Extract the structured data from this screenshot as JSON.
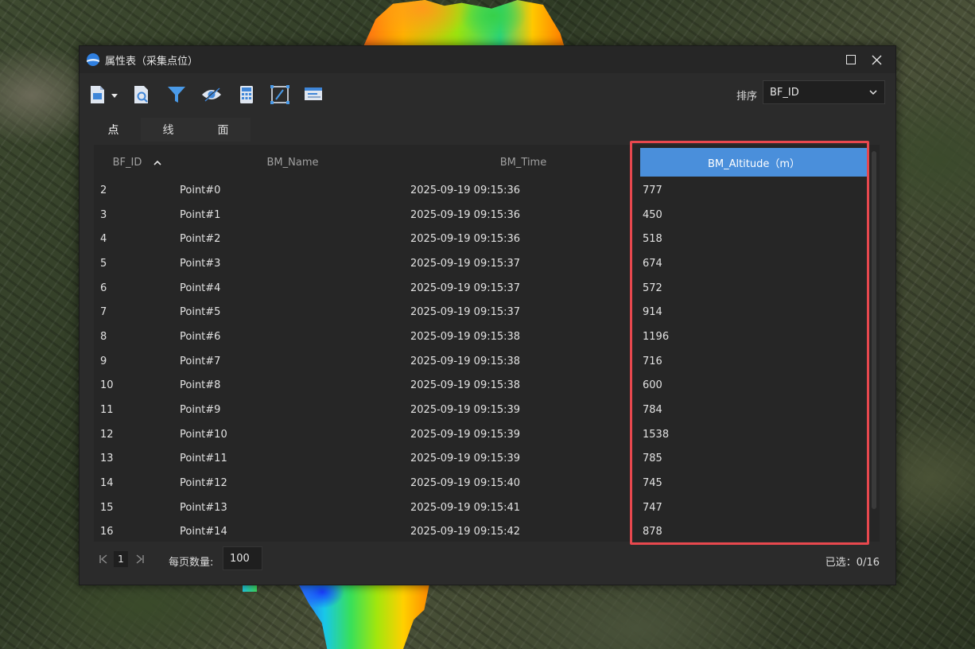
{
  "window": {
    "title": "属性表（采集点位）"
  },
  "toolbar": {
    "tools": [
      "export-icon",
      "zoom-to-icon",
      "filter-icon",
      "visibility-icon",
      "calculator-icon",
      "edit-field-icon",
      "message-icon"
    ],
    "sort_label": "排序",
    "sort_value": "BF_ID"
  },
  "tabs": [
    {
      "label": "点",
      "active": true
    },
    {
      "label": "线",
      "active": false
    },
    {
      "label": "面",
      "active": false
    }
  ],
  "table": {
    "columns": [
      "BF_ID",
      "BM_Name",
      "BM_Time",
      "BM_Altitude（m）"
    ],
    "sorted_column": "BF_ID",
    "sort_direction": "ascending",
    "selected_column": "BM_Altitude（m）",
    "rows": [
      [
        "2",
        "Point#0",
        "2025-09-19 09:15:36",
        "777"
      ],
      [
        "3",
        "Point#1",
        "2025-09-19 09:15:36",
        "450"
      ],
      [
        "4",
        "Point#2",
        "2025-09-19 09:15:36",
        "518"
      ],
      [
        "5",
        "Point#3",
        "2025-09-19 09:15:37",
        "674"
      ],
      [
        "6",
        "Point#4",
        "2025-09-19 09:15:37",
        "572"
      ],
      [
        "7",
        "Point#5",
        "2025-09-19 09:15:37",
        "914"
      ],
      [
        "8",
        "Point#6",
        "2025-09-19 09:15:38",
        "1196"
      ],
      [
        "9",
        "Point#7",
        "2025-09-19 09:15:38",
        "716"
      ],
      [
        "10",
        "Point#8",
        "2025-09-19 09:15:38",
        "600"
      ],
      [
        "11",
        "Point#9",
        "2025-09-19 09:15:39",
        "784"
      ],
      [
        "12",
        "Point#10",
        "2025-09-19 09:15:39",
        "1538"
      ],
      [
        "13",
        "Point#11",
        "2025-09-19 09:15:39",
        "785"
      ],
      [
        "14",
        "Point#12",
        "2025-09-19 09:15:40",
        "745"
      ],
      [
        "15",
        "Point#13",
        "2025-09-19 09:15:41",
        "747"
      ],
      [
        "16",
        "Point#14",
        "2025-09-19 09:15:42",
        "878"
      ]
    ]
  },
  "footer": {
    "page": "1",
    "per_page_label": "每页数量:",
    "per_page_value": "100",
    "selected_text": "已选：0/16"
  },
  "colors": {
    "accent": "#4a8fdb",
    "highlight_border": "#e8484e",
    "window_bg": "#2b2b2b"
  }
}
